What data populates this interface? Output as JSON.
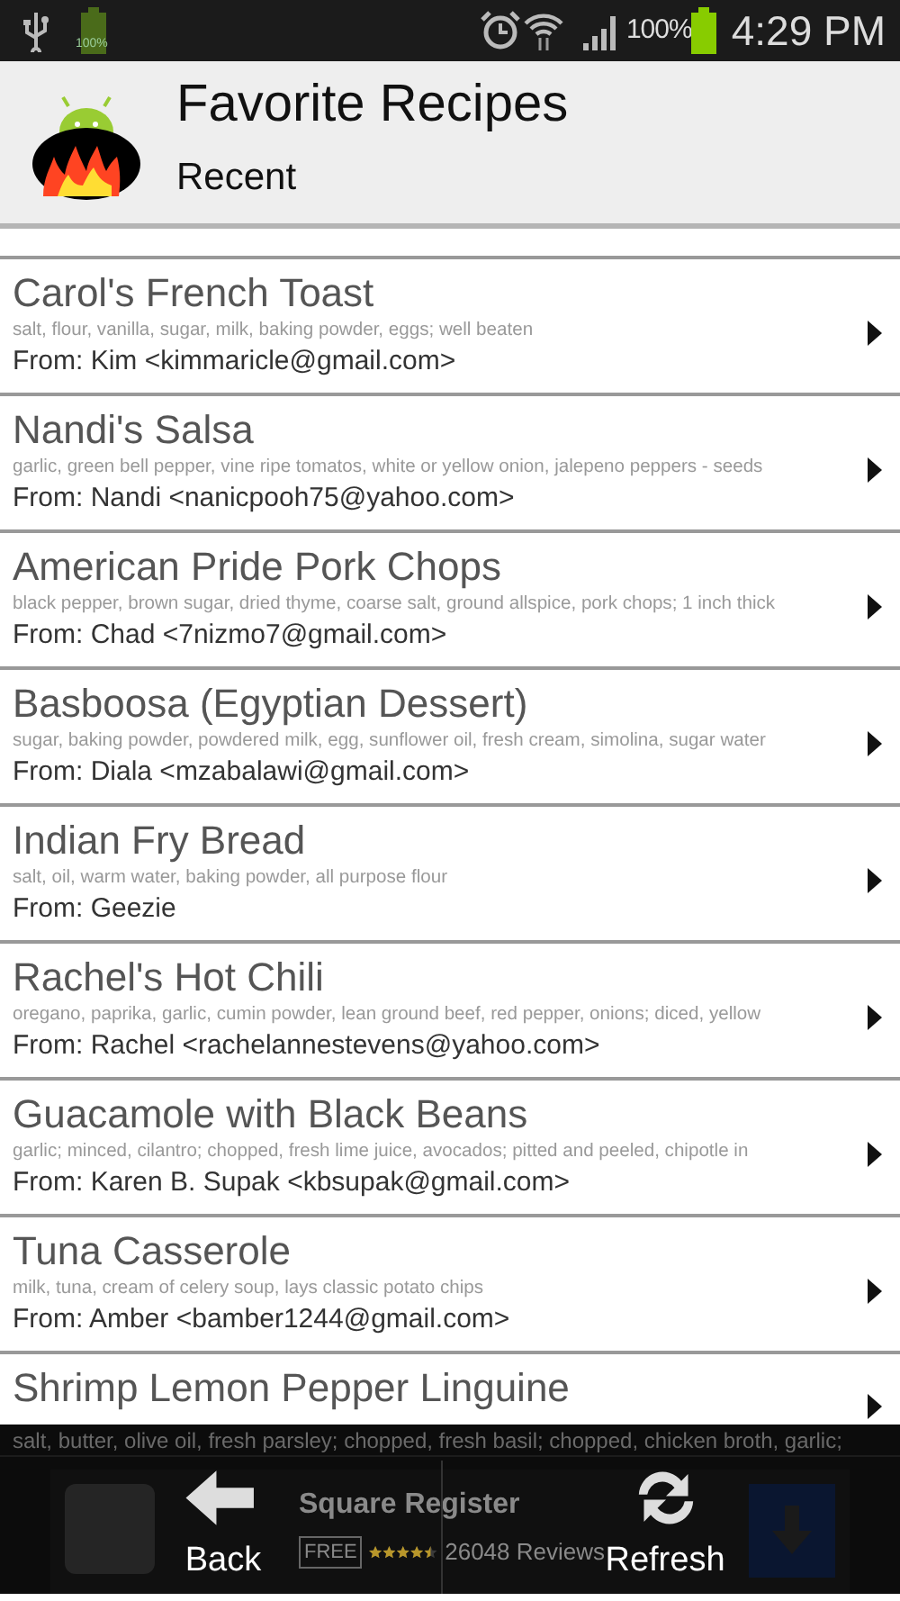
{
  "status_bar": {
    "battery_small_label": "100%",
    "battery_percent": "100%",
    "time": "4:29 PM"
  },
  "header": {
    "title": "Favorite Recipes",
    "subtitle": "Recent"
  },
  "recipes": [
    {
      "title": "Carol's French Toast",
      "ingredients": "salt, flour, vanilla, sugar, milk, baking powder, eggs; well beaten",
      "from": "From: Kim <kimmaricle@gmail.com>"
    },
    {
      "title": "Nandi's Salsa",
      "ingredients": "garlic, green bell pepper, vine ripe tomatos, white or yellow onion, jalepeno peppers - seeds",
      "from": "From: Nandi  <nanicpooh75@yahoo.com>"
    },
    {
      "title": "American Pride Pork Chops",
      "ingredients": "black pepper, brown sugar, dried thyme, coarse salt, ground allspice, pork chops; 1 inch thick",
      "from": "From: Chad <7nizmo7@gmail.com>"
    },
    {
      "title": "Basboosa (Egyptian Dessert)",
      "ingredients": "sugar, baking powder, powdered milk, egg, sunflower oil, fresh cream, simolina, sugar water",
      "from": "From: Diala <mzabalawi@gmail.com>"
    },
    {
      "title": "Indian Fry Bread",
      "ingredients": "salt, oil, warm water, baking powder, all purpose flour",
      "from": "From: Geezie"
    },
    {
      "title": "Rachel's Hot Chili",
      "ingredients": "oregano, paprika, garlic, cumin powder, lean ground beef, red pepper, onions; diced, yellow",
      "from": "From: Rachel <rachelannestevens@yahoo.com>"
    },
    {
      "title": "Guacamole with Black Beans",
      "ingredients": "garlic; minced, cilantro; chopped, fresh lime juice, avocados; pitted and peeled, chipotle in",
      "from": "From: Karen B. Supak <kbsupak@gmail.com>"
    },
    {
      "title": "Tuna Casserole",
      "ingredients": "milk, tuna, cream of celery soup, lays classic potato chips",
      "from": "From: Amber <bamber1244@gmail.com>"
    },
    {
      "title": "Shrimp Lemon Pepper Linguine",
      "ingredients": "salt, butter, olive oil, fresh parsley; chopped, fresh basil; chopped, chicken broth, garlic;"
    }
  ],
  "ad": {
    "title": "Square Register",
    "price": "FREE",
    "stars": 4.5,
    "reviews": "26048 Reviews"
  },
  "menu": [
    {
      "kind": "back",
      "label": "Back"
    },
    {
      "kind": "refresh",
      "label": "Refresh"
    }
  ]
}
